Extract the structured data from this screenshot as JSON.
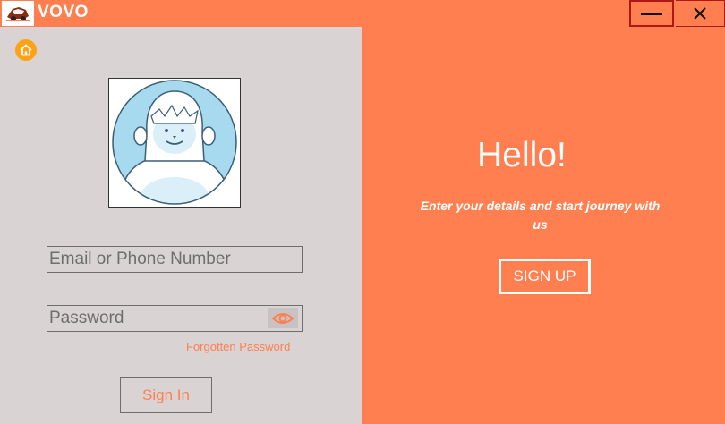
{
  "window": {
    "title": "VOVO",
    "minimize_icon": "minimize-icon",
    "close_icon": "close-icon"
  },
  "login": {
    "home_icon": "home-icon",
    "avatar_icon": "yeti-avatar-icon",
    "email_placeholder": "Email or Phone Number",
    "password_placeholder": "Password",
    "show_password_icon": "eye-icon",
    "forgot_password": "Forgotten Password",
    "sign_in": "Sign In"
  },
  "welcome": {
    "heading": "Hello!",
    "subtitle": "Enter your details and start journey with us",
    "sign_up": "SIGN UP"
  },
  "colors": {
    "accent": "#ff7f50",
    "panel": "#d9d3d3",
    "home_icon": "#ffa215"
  }
}
